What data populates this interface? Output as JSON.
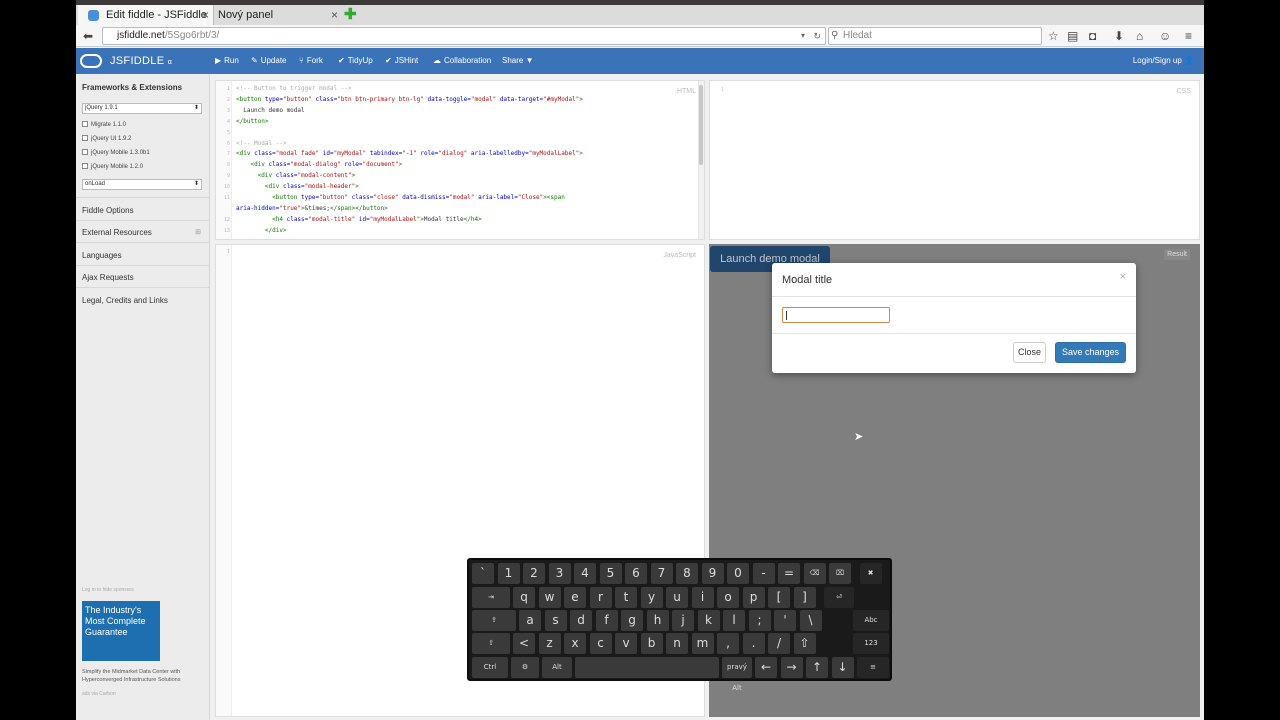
{
  "browser": {
    "tabs": [
      {
        "label": "Edit fiddle - JSFiddle",
        "active": true
      },
      {
        "label": "Nový panel",
        "active": false
      }
    ],
    "url_host": "jsfiddle.net",
    "url_path": "/5Sgo6rbt/3/",
    "search_placeholder": "Hledat"
  },
  "jsfiddle": {
    "brand": "JSFIDDLE",
    "brand_sub": "α",
    "toolbar": [
      {
        "label": "Run",
        "icon": "play-icon",
        "glyph": "▶"
      },
      {
        "label": "Update",
        "icon": "pencil-icon",
        "glyph": "✎"
      },
      {
        "label": "Fork",
        "icon": "fork-icon",
        "glyph": "⑂"
      },
      {
        "label": "TidyUp",
        "icon": "check-icon",
        "glyph": "✔"
      },
      {
        "label": "JSHint",
        "icon": "check-icon",
        "glyph": "✔"
      },
      {
        "label": "Collaboration",
        "icon": "users-icon",
        "glyph": "☁"
      },
      {
        "label": "Share ▼",
        "icon": "",
        "glyph": ""
      }
    ],
    "login": "Login/Sign up"
  },
  "sidebar": {
    "title": "Frameworks & Extensions",
    "framework_select": "jQuery 1.9.1",
    "extensions": [
      "Migrate 1.1.0",
      "jQuery UI 1.9.2",
      "jQuery Mobile 1.3.0b1",
      "jQuery Mobile 1.2.0"
    ],
    "load_select": "onLoad",
    "links": [
      "Fiddle Options",
      "External Resources",
      "Languages",
      "Ajax Requests",
      "Legal, Credits and Links"
    ],
    "sponsor_note": "Log in to hide sponsors",
    "ad_title": "The Industry's Most Complete Guarantee",
    "ad_text": "Simplify the Midmarket Data Center with Hyperconverged Infrastructure Solutions",
    "ad_via": "ads via Carbon"
  },
  "panels": {
    "html_label": "HTML",
    "css_label": "CSS",
    "js_label": "JavaScript",
    "result_label": "Result",
    "css_line_no": "1",
    "js_line_no": "1"
  },
  "code": [
    {
      "n": "1",
      "html": "<span class='cm'>&lt;!-- Button to trigger modal --&gt;</span>"
    },
    {
      "n": "2",
      "html": "<span class='tg'>&lt;button</span> <span class='at'>type=</span><span class='st'>\"button\"</span> <span class='at'>class=</span><span class='st'>\"btn btn-primary btn-lg\"</span> <span class='at'>data-toggle=</span><span class='st'>\"modal\"</span> <span class='at'>data-target=</span><span class='st'>\"#myModal\"</span><span class='tg'>&gt;</span>"
    },
    {
      "n": "3",
      "html": "  Launch demo modal"
    },
    {
      "n": "4",
      "html": "<span class='tg'>&lt;/button&gt;</span>"
    },
    {
      "n": "5",
      "html": ""
    },
    {
      "n": "6",
      "html": "<span class='cm'>&lt;!-- Modal --&gt;</span>"
    },
    {
      "n": "7",
      "html": "<span class='tg'>&lt;div</span> <span class='at'>class=</span><span class='st'>\"modal fade\"</span> <span class='at'>id=</span><span class='st'>\"myModal\"</span> <span class='at'>tabindex=</span><span class='st'>\"-1\"</span> <span class='at'>role=</span><span class='st'>\"dialog\"</span> <span class='at'>aria-labelledby=</span><span class='st'>\"myModalLabel\"</span><span class='tg'>&gt;</span>"
    },
    {
      "n": "8",
      "html": "    <span class='tg'>&lt;div</span> <span class='at'>class=</span><span class='st'>\"modal-dialog\"</span> <span class='at'>role=</span><span class='st'>\"document\"</span><span class='tg'>&gt;</span>"
    },
    {
      "n": "9",
      "html": "      <span class='tg'>&lt;div</span> <span class='at'>class=</span><span class='st'>\"modal-content\"</span><span class='tg'>&gt;</span>"
    },
    {
      "n": "10",
      "html": "        <span class='tg'>&lt;div</span> <span class='at'>class=</span><span class='st'>\"modal-header\"</span><span class='tg'>&gt;</span>"
    },
    {
      "n": "11",
      "html": "          <span class='tg'>&lt;button</span> <span class='at'>type=</span><span class='st'>\"button\"</span> <span class='at'>class=</span><span class='st'>\"close\"</span> <span class='at'>data-dismiss=</span><span class='st'>\"modal\"</span> <span class='at'>aria-label=</span><span class='st'>\"Close\"</span><span class='tg'>&gt;&lt;span</span>"
    },
    {
      "n": "",
      "html": "<span class='at'>aria-hidden=</span><span class='st'>\"true\"</span><span class='tg'>&gt;</span>&amp;times;<span class='tg'>&lt;/span&gt;&lt;/button&gt;</span>"
    },
    {
      "n": "12",
      "html": "          <span class='tg'>&lt;h4</span> <span class='at'>class=</span><span class='st'>\"modal-title\"</span> <span class='at'>id=</span><span class='st'>\"myModalLabel\"</span><span class='tg'>&gt;</span>Modal title<span class='tg'>&lt;/h4&gt;</span>"
    },
    {
      "n": "13",
      "html": "        <span class='tg'>&lt;/div&gt;</span>"
    }
  ],
  "result": {
    "launch_button": "Launch demo modal",
    "modal_title": "Modal title",
    "modal_close_glyph": "×",
    "input_value": "",
    "close_button": "Close",
    "save_button": "Save changes"
  },
  "keyboard": {
    "row1": [
      "`",
      "1",
      "2",
      "3",
      "4",
      "5",
      "6",
      "7",
      "8",
      "9",
      "0",
      "-",
      "="
    ],
    "row2": [
      "q",
      "w",
      "e",
      "r",
      "t",
      "y",
      "u",
      "i",
      "o",
      "p",
      "[",
      "]"
    ],
    "row3": [
      "a",
      "s",
      "d",
      "f",
      "g",
      "h",
      "j",
      "k",
      "l",
      ";",
      "'",
      "\\"
    ],
    "row4": [
      "<",
      "z",
      "x",
      "c",
      "v",
      "b",
      "n",
      "m",
      ",",
      ".",
      "/",
      "⇧"
    ],
    "tab": "⇥",
    "caps": "⇪",
    "shift": "⇧",
    "backspace": "⌫",
    "clear": "⌧",
    "close": "✖",
    "enter": "⏎",
    "ctrl": "Ctrl",
    "alt": "Alt",
    "altgr": "pravý Alt",
    "abc": "Abc",
    "num": "123",
    "arrows": [
      "←",
      "→",
      "↑",
      "↓"
    ],
    "menu": "≡",
    "settings": "⚙"
  }
}
